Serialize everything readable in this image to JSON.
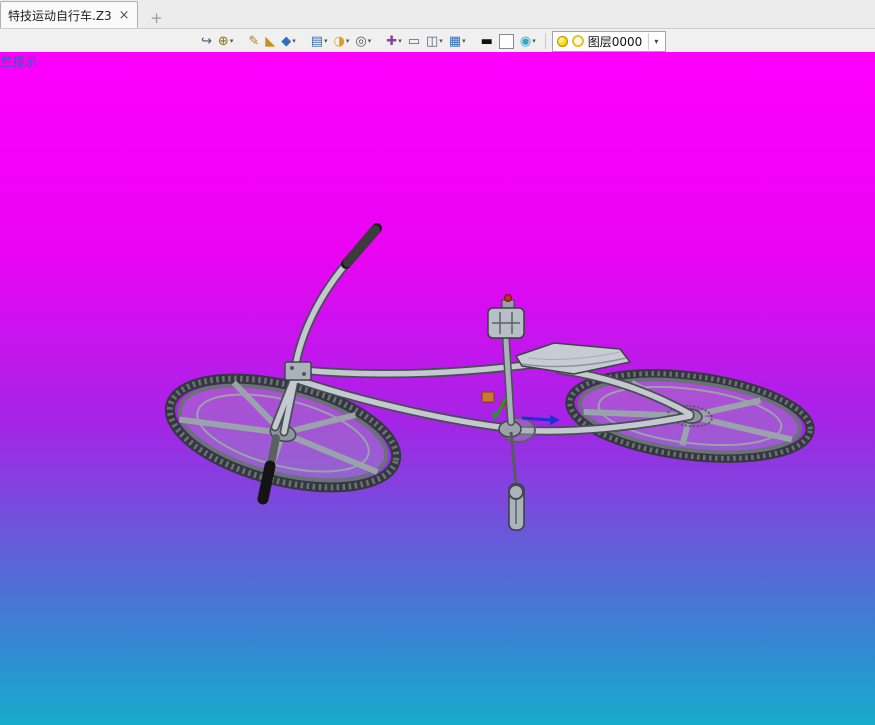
{
  "window": {
    "tab_title": "特技运动自行车.Z3",
    "tab_close": "×",
    "new_tab": "+"
  },
  "toolbar": {
    "icons": [
      {
        "name": "exit-icon",
        "glyph": "↪",
        "color": "#445566",
        "dropdown": false
      },
      {
        "name": "query-tool-icon",
        "glyph": "⊕",
        "color": "#8a6d1a",
        "dropdown": true
      },
      {
        "name": "edit-sketch-icon",
        "glyph": "✎",
        "color": "#b08020",
        "dropdown": false,
        "gap": true
      },
      {
        "name": "chamfer-icon",
        "glyph": "◣",
        "color": "#c89020",
        "dropdown": false
      },
      {
        "name": "solid-cube-icon",
        "glyph": "◆",
        "color": "#2f6fbf",
        "dropdown": true
      },
      {
        "name": "display-mode-icon",
        "glyph": "▤",
        "color": "#3a6fae",
        "dropdown": true,
        "gap": true
      },
      {
        "name": "render-style-icon",
        "glyph": "◑",
        "color": "#d8a020",
        "dropdown": true
      },
      {
        "name": "zoom-icon",
        "glyph": "◎",
        "color": "#555566",
        "dropdown": true
      },
      {
        "name": "align-view-icon",
        "glyph": "✚",
        "color": "#884499",
        "dropdown": true,
        "gap": true
      },
      {
        "name": "selection-frame-icon",
        "glyph": "▭",
        "color": "#446688",
        "dropdown": false
      },
      {
        "name": "split-window-icon",
        "glyph": "◫",
        "color": "#556677",
        "dropdown": true
      },
      {
        "name": "monitor-icon",
        "glyph": "▦",
        "color": "#2f6fbf",
        "dropdown": true
      },
      {
        "name": "line-width-icon",
        "glyph": "▬",
        "color": "#111111",
        "dropdown": false,
        "gap": true
      },
      {
        "name": "background-color-icon",
        "glyph": "",
        "color": "#ffffff",
        "dropdown": false,
        "boxed": true
      },
      {
        "name": "visibility-icon",
        "glyph": "◉",
        "color": "#2fa8c8",
        "dropdown": true
      }
    ],
    "layer_selector": {
      "value": "图层0000",
      "arrow": "▾"
    }
  },
  "viewport": {
    "hint_text": "些提示·"
  },
  "colors": {
    "bg_stops": [
      "#fd00fd",
      "#ea04f4",
      "#a524e6",
      "#5e62d8",
      "#2e8ed2",
      "#18accc"
    ],
    "bg_positions": [
      0,
      30,
      55,
      75,
      90,
      100
    ]
  }
}
